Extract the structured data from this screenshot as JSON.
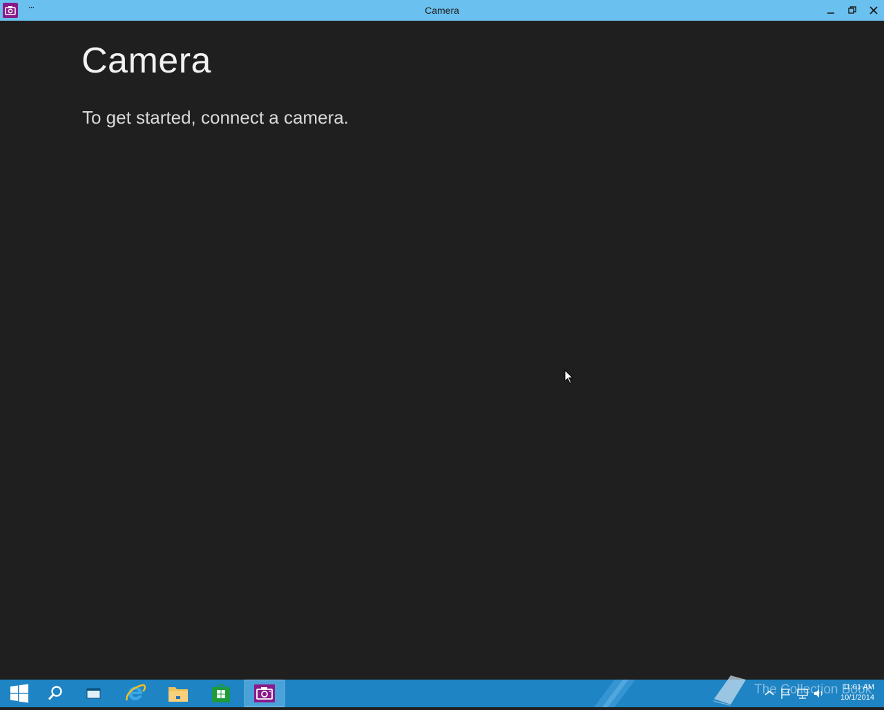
{
  "window": {
    "title": "Camera",
    "more_label": "···"
  },
  "main": {
    "title": "Camera",
    "message": "To get started, connect a camera."
  },
  "taskbar": {
    "items": [
      "start",
      "search",
      "task-view",
      "internet-explorer",
      "file-explorer",
      "store",
      "camera"
    ],
    "active": "camera"
  },
  "tray": {
    "time": "11:01 AM",
    "date": "10/1/2014"
  },
  "watermark": {
    "text": "The Collection Book"
  },
  "colors": {
    "titlebar": "#6ac0ee",
    "background": "#1f1f1f",
    "taskbar": "#1e84c4",
    "camera_accent": "#8a1a8a"
  }
}
